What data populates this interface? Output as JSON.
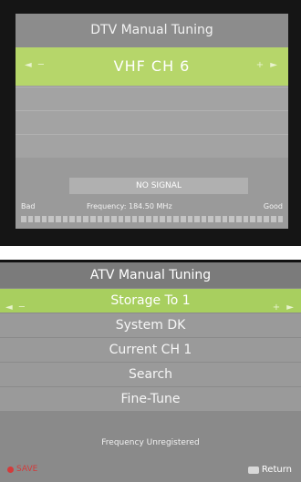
{
  "dtv": {
    "title": "DTV Manual Tuning",
    "channel": "VHF  CH  6",
    "left_arrows": "◄ ─",
    "right_arrows": "+ ►",
    "status": "NO SIGNAL",
    "bad_label": "Bad",
    "frequency": "Frequency:  184.50 MHz",
    "good_label": "Good",
    "signal_quality": 0
  },
  "atv": {
    "title": "ATV Manual Tuning",
    "left_arrows": "◄ ─",
    "right_arrows": "+ ►",
    "items": [
      "Storage To 1",
      "System DK",
      "Current CH 1",
      "Search",
      "Fine-Tune"
    ],
    "info": "Frequency Unregistered",
    "save_label": "SAVE",
    "return_label": "Return"
  }
}
